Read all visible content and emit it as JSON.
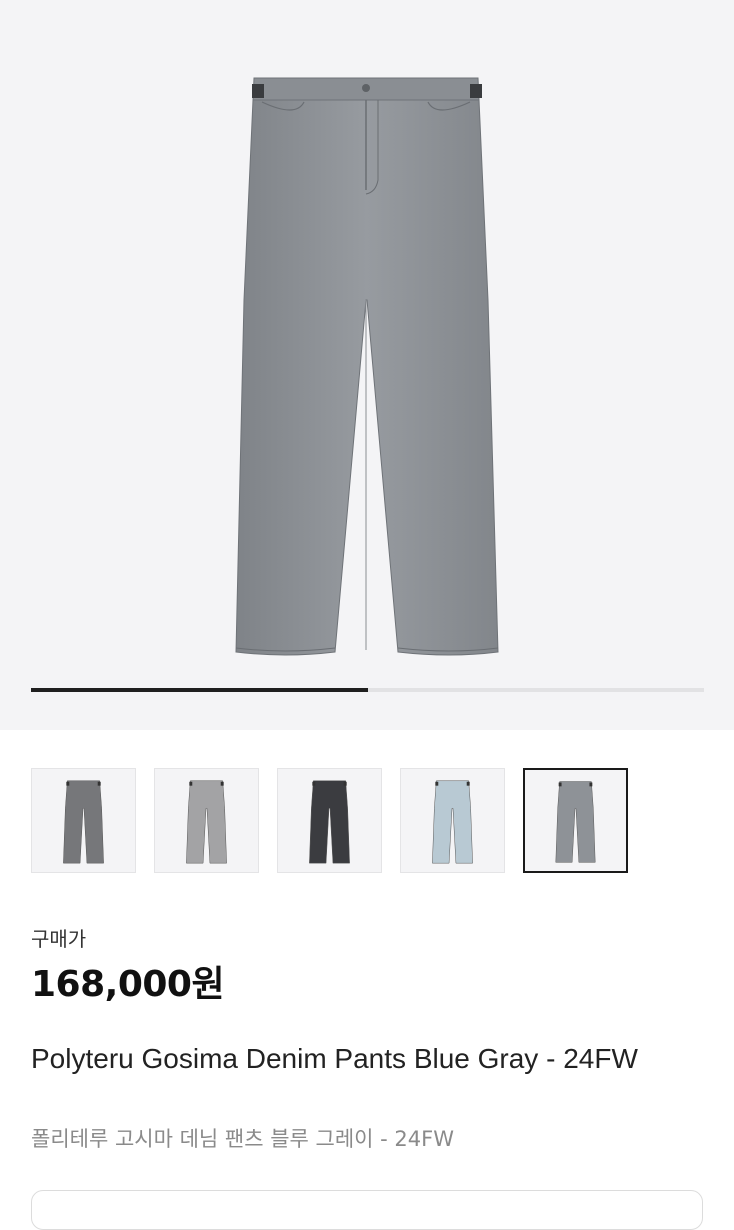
{
  "product": {
    "price_label": "구매가",
    "price": "168,000원",
    "title": "Polyteru Gosima Denim Pants Blue Gray - 24FW",
    "subtitle": "폴리테루 고시마 데님 팬츠 블루 그레이 - 24FW"
  },
  "gallery": {
    "progress": 0.5,
    "colors": {
      "hero_bg": "#f4f4f6",
      "main_denim": "#8d9196"
    },
    "thumbnails": [
      {
        "name": "thumbnail-gray-pants",
        "color": "#76777a",
        "selected": false
      },
      {
        "name": "thumbnail-light-gray-pants",
        "color": "#a3a3a5",
        "selected": false
      },
      {
        "name": "thumbnail-black-pants",
        "color": "#3b3c40",
        "selected": false
      },
      {
        "name": "thumbnail-light-blue-pants",
        "color": "#b8c9d3",
        "selected": false
      },
      {
        "name": "thumbnail-blue-gray-pants",
        "color": "#8e9297",
        "selected": true
      }
    ]
  }
}
